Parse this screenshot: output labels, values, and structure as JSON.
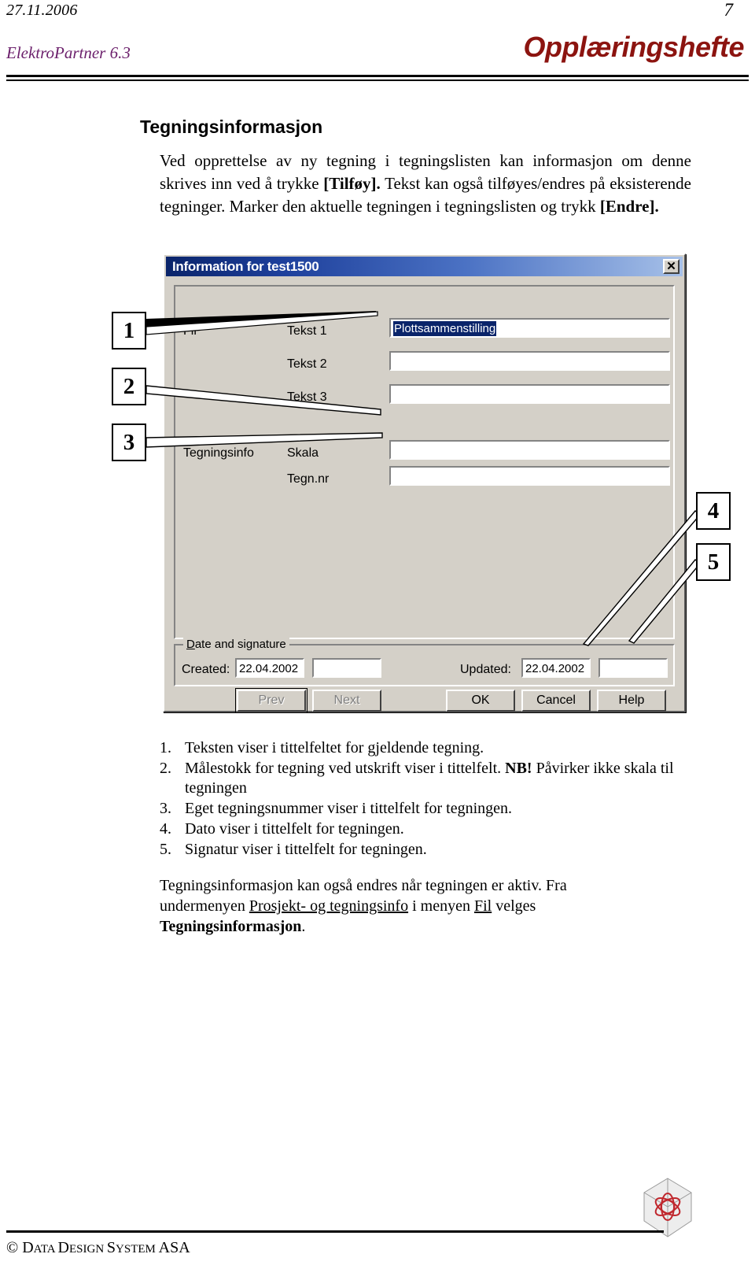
{
  "header": {
    "date": "27.11.2006",
    "page_number": "7",
    "product": "ElektroPartner 6.3",
    "title": "Opplæringshefte",
    "product_color": "#6b1f6b",
    "title_color": "#8c1410"
  },
  "section": {
    "heading": "Tegningsinformasjon",
    "intro_part1": "Ved opprettelse av ny tegning i tegningslisten kan informasjon om denne skrives inn ved å trykke ",
    "intro_bold1": "[Tilføy].",
    "intro_part2": " Tekst kan også tilføyes/endres på eksisterende tegninger. Marker den aktuelle tegningen i tegningslisten og trykk ",
    "intro_bold2": "[Endre]."
  },
  "dialog": {
    "title": "Information for test1500",
    "close_label": "✕",
    "group_labels": {
      "fil": "Fil",
      "tegningsinfo": "Tegningsinfo"
    },
    "fields": [
      {
        "label": "Tekst 1",
        "value": "Plottsammenstilling",
        "selected": true
      },
      {
        "label": "Tekst 2",
        "value": "",
        "selected": false
      },
      {
        "label": "Tekst 3",
        "value": "",
        "selected": false
      },
      {
        "label": "Skala",
        "value": "",
        "selected": false
      },
      {
        "label": "Tegn.nr",
        "value": "",
        "selected": false
      }
    ],
    "date_group": {
      "legend": "Date and signature",
      "created_label": "Created:",
      "created_date": "22.04.2002",
      "created_sign": "",
      "updated_label": "Updated:",
      "updated_date": "22.04.2002",
      "updated_sign": ""
    },
    "buttons": [
      {
        "label": "Prev",
        "state": "disabled"
      },
      {
        "label": "Next",
        "state": "disabled"
      },
      {
        "label": "OK",
        "state": "enabled"
      },
      {
        "label": "Cancel",
        "state": "enabled"
      },
      {
        "label": "Help",
        "state": "enabled"
      }
    ]
  },
  "callouts": [
    {
      "number": "1"
    },
    {
      "number": "2"
    },
    {
      "number": "3"
    },
    {
      "number": "4"
    },
    {
      "number": "5"
    }
  ],
  "notes": [
    {
      "num": "1.",
      "text": "Teksten viser i tittelfeltet for gjeldende tegning."
    },
    {
      "num": "2.",
      "text_a": "Målestokk for tegning ved utskrift viser i tittelfelt. ",
      "bold": "NB!",
      "text_b": " Påvirker ikke skala til tegningen"
    },
    {
      "num": "3.",
      "text": "Eget tegningsnummer viser i tittelfelt for tegningen."
    },
    {
      "num": "4.",
      "text": "Dato viser i tittelfelt for tegningen."
    },
    {
      "num": "5.",
      "text": "Signatur viser i tittelfelt for tegningen."
    }
  ],
  "closing": {
    "part1": "Tegningsinformasjon kan også endres når tegningen er aktiv. Fra undermenyen ",
    "link1": "Prosjekt- og tegningsinfo",
    "part2": " i menyen ",
    "link2": "Fil",
    "part3": " velges ",
    "bold": "Tegningsinformasjon",
    "part4": "."
  },
  "footer": {
    "copyright_symbol": "©",
    "company_first": "D",
    "company_rest_1": "ATA ",
    "company_second": "D",
    "company_rest_2": "ESIGN ",
    "company_third": "S",
    "company_rest_3": "YSTEM ",
    "company_abbrev": "ASA",
    "logo_accent": "#c0272d"
  }
}
